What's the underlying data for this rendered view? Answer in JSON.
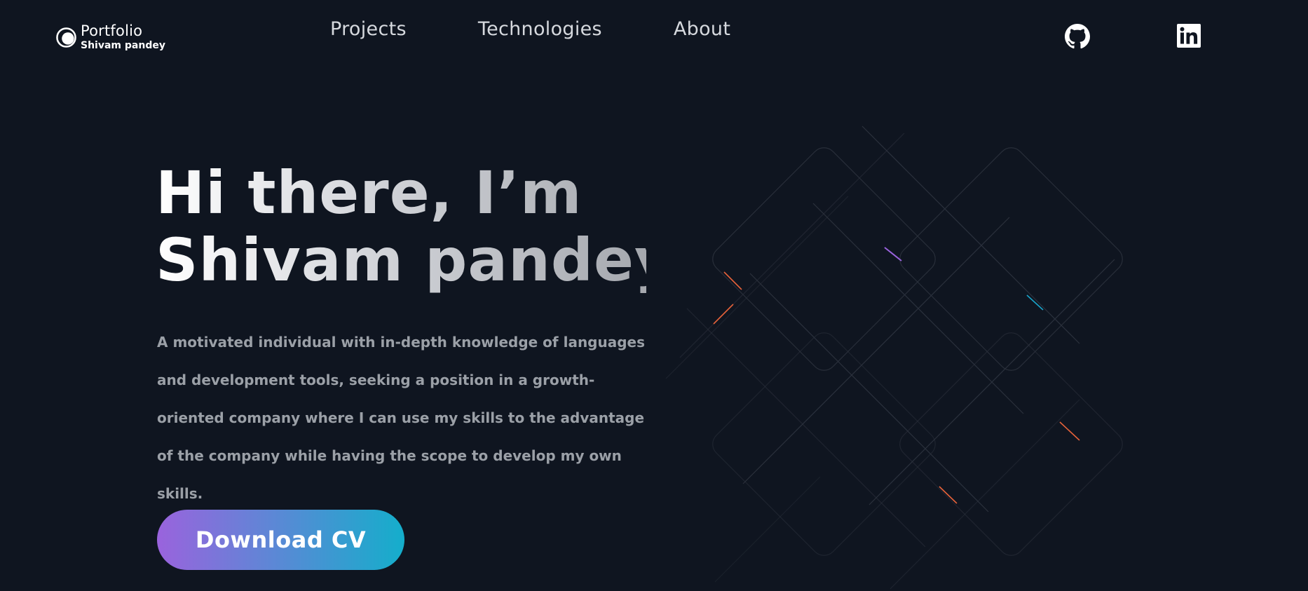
{
  "header": {
    "logo": {
      "title": "Portfolio",
      "subtitle": "Shivam pandey"
    },
    "nav": [
      {
        "label": "Projects"
      },
      {
        "label": "Technologies"
      },
      {
        "label": "About"
      }
    ],
    "social": [
      {
        "icon": "github-icon"
      },
      {
        "icon": "linkedin-icon"
      }
    ]
  },
  "hero": {
    "title_line1": "Hi there, I’m",
    "title_line2": "Shivam pandey.",
    "bio": "A motivated individual with in-depth knowledge of languages and development tools, seeking a position in a growth-oriented company where I can use my skills to the advantage of the company while having the scope to develop my own skills.",
    "cta_label": "Download CV"
  },
  "theme": {
    "background": "#0f1520",
    "gradient_start": "#9a63dd",
    "gradient_end": "#14aecb",
    "accent_orange": "#e5623a",
    "accent_purple": "#9a63dd",
    "accent_cyan": "#1aa3c9"
  }
}
